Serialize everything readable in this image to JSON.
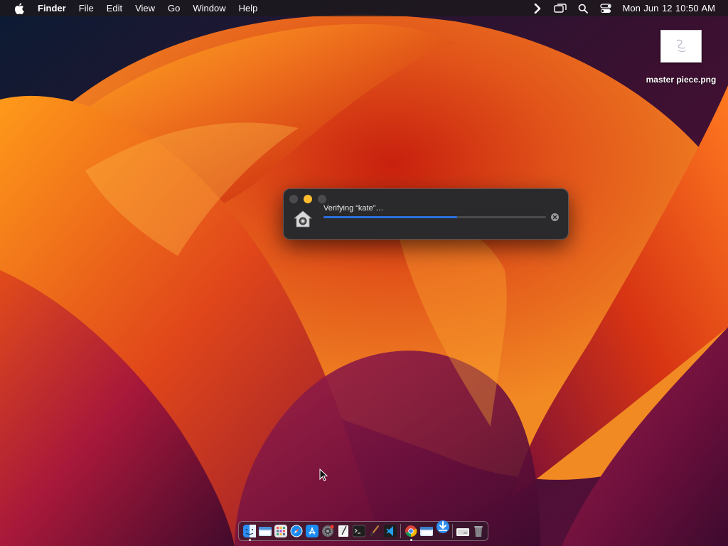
{
  "menubar": {
    "app_name": "Finder",
    "menus": [
      "File",
      "Edit",
      "View",
      "Go",
      "Window",
      "Help"
    ],
    "status_icons": [
      "chevron-right-icon",
      "screen-mirroring-icon",
      "spotlight-search-icon",
      "control-center-icon"
    ],
    "clock": "Mon Jun 12  10:50 AM"
  },
  "desktop_file": {
    "label": "master piece.png"
  },
  "verify_window": {
    "label": "Verifying “kate”…",
    "progress": 0.6,
    "accent_color": "#2c6fe0",
    "buttons": {
      "close": "close-button",
      "minimize": "minimize-button",
      "zoom": "zoom-button",
      "cancel": "cancel-icon"
    }
  },
  "dock": {
    "items": [
      {
        "name": "finder-icon",
        "running": true
      },
      {
        "name": "folder-window-icon",
        "running": false
      },
      {
        "name": "launchpad-icon",
        "running": false
      },
      {
        "name": "safari-icon",
        "running": false
      },
      {
        "name": "app-store-icon",
        "running": false
      },
      {
        "name": "system-settings-icon",
        "running": false
      },
      {
        "name": "textedit-icon",
        "running": false
      },
      {
        "name": "terminal-icon",
        "running": false
      },
      {
        "name": "brush-icon",
        "running": false
      },
      {
        "name": "vscode-icon",
        "running": false
      },
      {
        "name": "chrome-icon",
        "running": true
      },
      {
        "name": "finder-window-icon",
        "running": false
      },
      {
        "name": "installer-icon",
        "running": false
      },
      {
        "name": "downloads-icon",
        "running": false
      },
      {
        "name": "trash-icon",
        "running": false
      }
    ]
  },
  "colors": {
    "menubar_bg": "#1c181c",
    "window_bg": "#2a2a2c",
    "minimize_yellow": "#febc2e",
    "progress_blue": "#2c6fe0"
  }
}
